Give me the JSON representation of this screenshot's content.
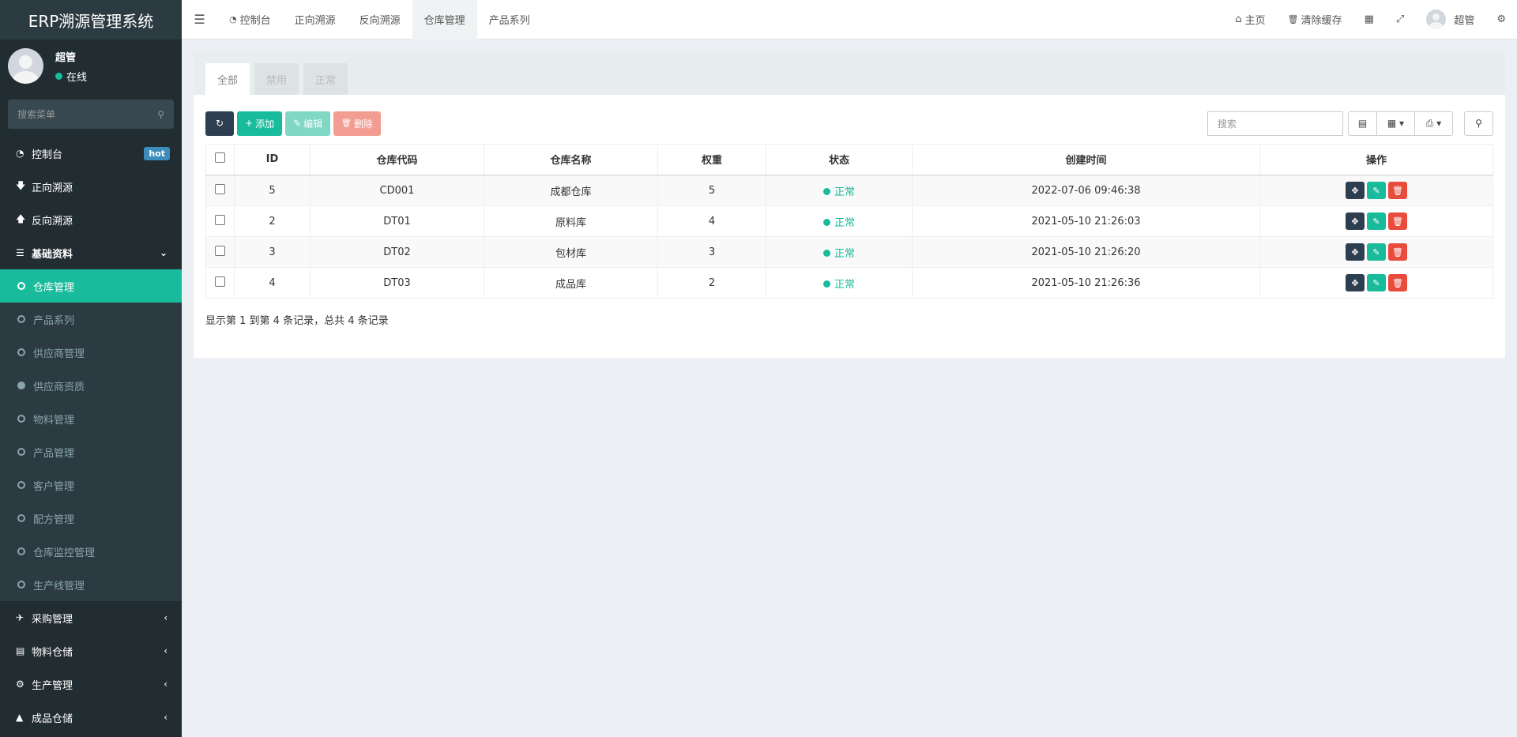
{
  "sidebar": {
    "brand": "ERP溯源管理系统",
    "user": {
      "name": "超管",
      "status": "在线"
    },
    "search_placeholder": "搜索菜单",
    "menu": {
      "dashboard": "控制台",
      "hot": "hot",
      "forward": "正向溯源",
      "reverse": "反向溯源",
      "basic": "基础资料",
      "sub": [
        "仓库管理",
        "产品系列",
        "供应商管理",
        "供应商资质",
        "物料管理",
        "产品管理",
        "客户管理",
        "配方管理",
        "仓库监控管理",
        "生产线管理"
      ],
      "purchase": "采购管理",
      "material_store": "物料仓储",
      "production": "生产管理",
      "product_store": "成品仓储"
    }
  },
  "topbar": {
    "nav": [
      "控制台",
      "正向溯源",
      "反向溯源",
      "仓库管理",
      "产品系列"
    ],
    "home": "主页",
    "clear_cache": "清除缓存",
    "user": "超管"
  },
  "tabs": [
    "全部",
    "禁用",
    "正常"
  ],
  "toolbar": {
    "add": "添加",
    "edit": "编辑",
    "delete": "删除",
    "search_placeholder": "搜索"
  },
  "table": {
    "headers": [
      "ID",
      "仓库代码",
      "仓库名称",
      "权重",
      "状态",
      "创建时间",
      "操作"
    ],
    "rows": [
      {
        "id": "5",
        "code": "CD001",
        "name": "成都仓库",
        "weight": "5",
        "status": "正常",
        "created": "2022-07-06 09:46:38"
      },
      {
        "id": "2",
        "code": "DT01",
        "name": "原料库",
        "weight": "4",
        "status": "正常",
        "created": "2021-05-10 21:26:03"
      },
      {
        "id": "3",
        "code": "DT02",
        "name": "包材库",
        "weight": "3",
        "status": "正常",
        "created": "2021-05-10 21:26:20"
      },
      {
        "id": "4",
        "code": "DT03",
        "name": "成品库",
        "weight": "2",
        "status": "正常",
        "created": "2021-05-10 21:26:36"
      }
    ]
  },
  "pagination_text": "显示第 1 到第 4 条记录，总共 4 条记录",
  "colors": {
    "accent": "#18bc9c",
    "sidebar": "#222d32",
    "dark": "#2c3e50",
    "danger": "#e74c3c"
  }
}
